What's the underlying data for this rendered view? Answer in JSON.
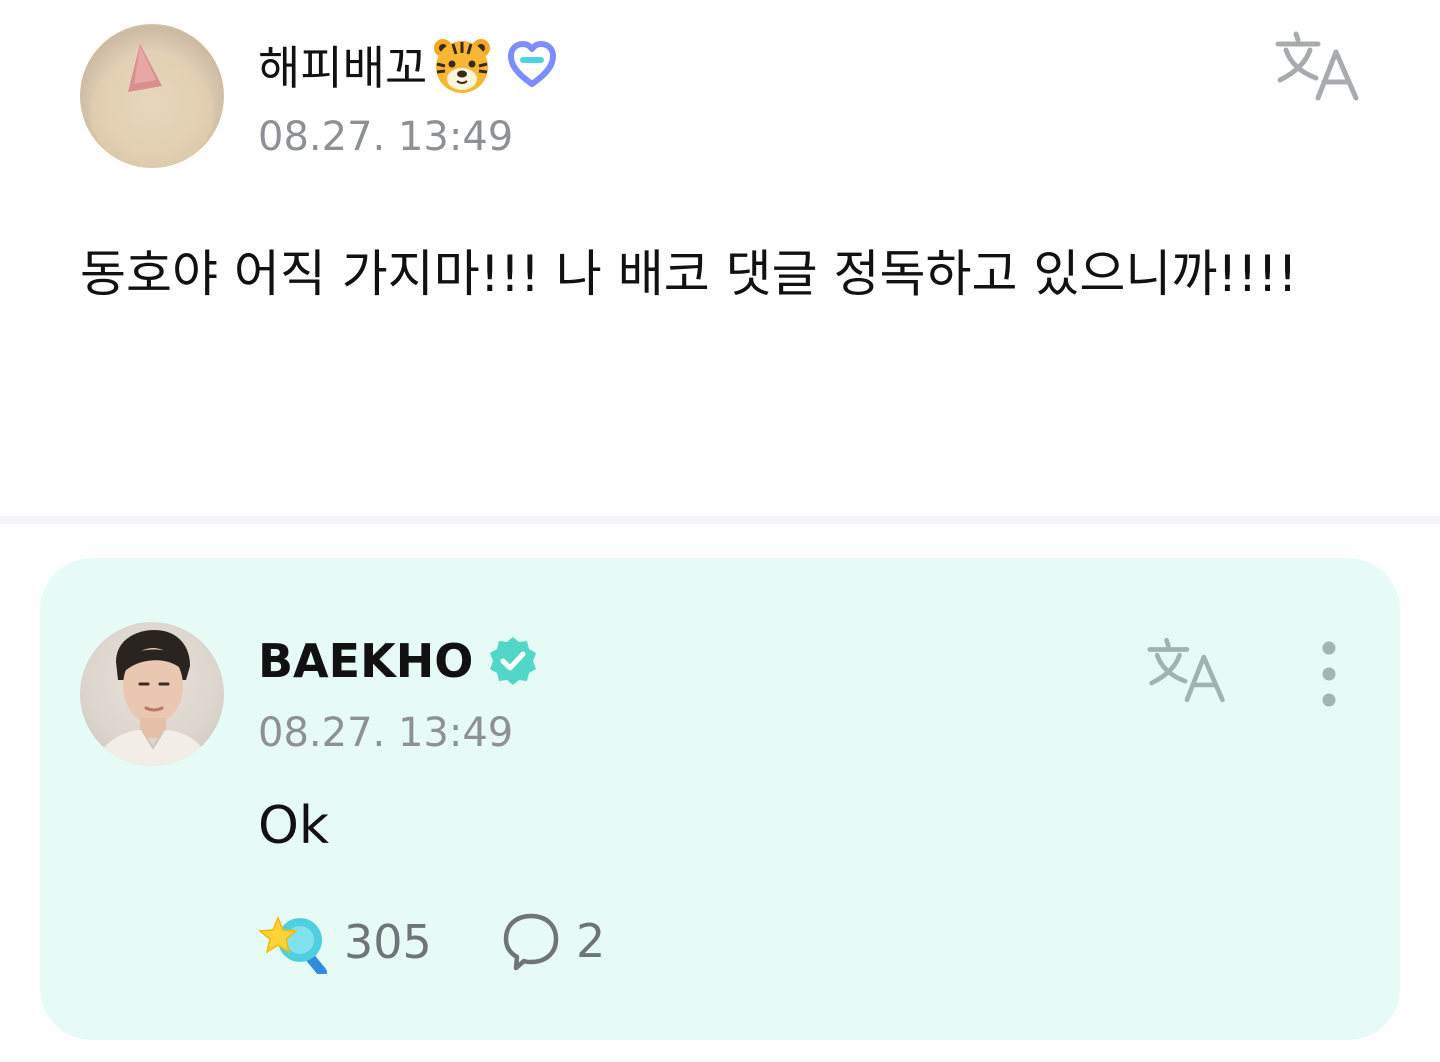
{
  "post": {
    "username": "해피배꼬",
    "timestamp": "08.27. 13:49",
    "body": "동호야 어직 가지마!!! 나 배코 댓글 정독하고 있으니까!!!!",
    "icons": [
      "tiger-face-emoji",
      "membership-badge-icon",
      "translate-icon"
    ]
  },
  "reply": {
    "username": "BAEKHO",
    "timestamp": "08.27. 13:49",
    "body": "Ok",
    "like_count": "305",
    "comment_count": "2",
    "icons": [
      "verified-badge-icon",
      "translate-icon",
      "more-options-icon",
      "star-wand-like-icon",
      "comment-bubble-icon"
    ]
  },
  "colors": {
    "card_background": "#e6fbf6",
    "verified": "#52d6c7",
    "membership_badge": "#7d8cff",
    "muted_text": "#8d9095"
  }
}
